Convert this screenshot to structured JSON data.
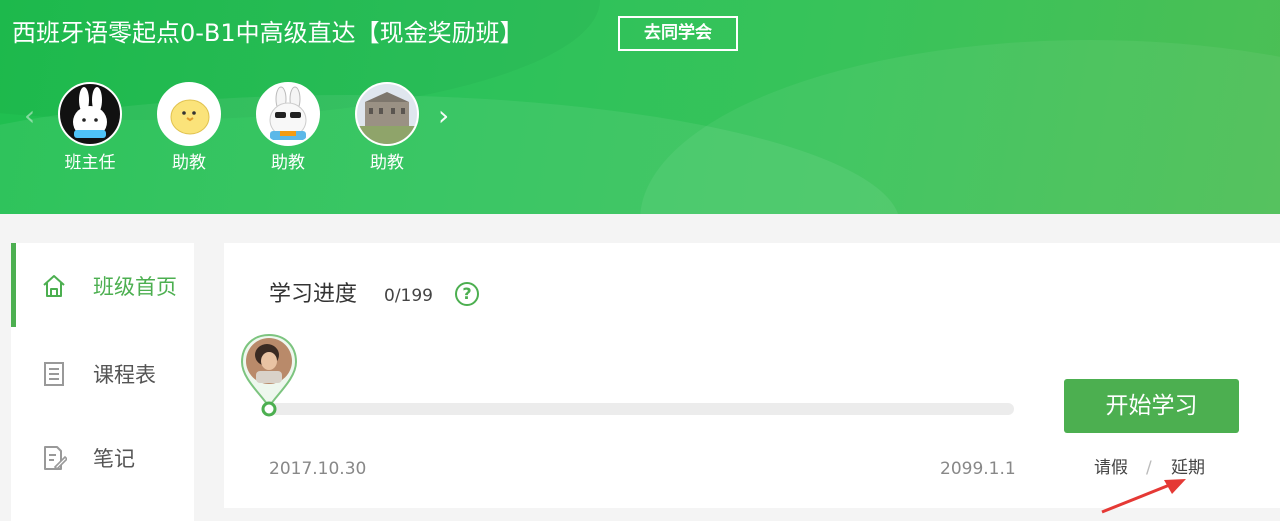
{
  "header": {
    "class_title": "西班牙语零起点0-B1中高级直达【现金奖励班】",
    "go_classmates_button": "去同学会",
    "prev_arrow": "‹",
    "next_arrow": "›",
    "staff": [
      {
        "role": "班主任",
        "avatar": "white-rabbit-avatar"
      },
      {
        "role": "助教",
        "avatar": "yellow-chick-avatar"
      },
      {
        "role": "助教",
        "avatar": "rabbit-sunglasses-avatar"
      },
      {
        "role": "助教",
        "avatar": "building-photo-avatar"
      }
    ]
  },
  "sidebar": {
    "items": [
      {
        "label": "班级首页",
        "icon": "home-icon",
        "active": true
      },
      {
        "label": "课程表",
        "icon": "schedule-icon",
        "active": false
      },
      {
        "label": "笔记",
        "icon": "notes-icon",
        "active": false
      }
    ]
  },
  "main": {
    "progress_title": "学习进度",
    "progress_count": "0/199",
    "help_symbol": "?",
    "progress": {
      "completed": 0,
      "total": 199
    },
    "start_date": "2017.10.30",
    "end_date": "2099.1.1",
    "start_button": "开始学习",
    "leave_link": "请假",
    "separator": "/",
    "delay_link": "延期"
  },
  "colors": {
    "accent": "#4caf50",
    "header_green": "#2cc25a",
    "annotation_red": "#e53935"
  }
}
